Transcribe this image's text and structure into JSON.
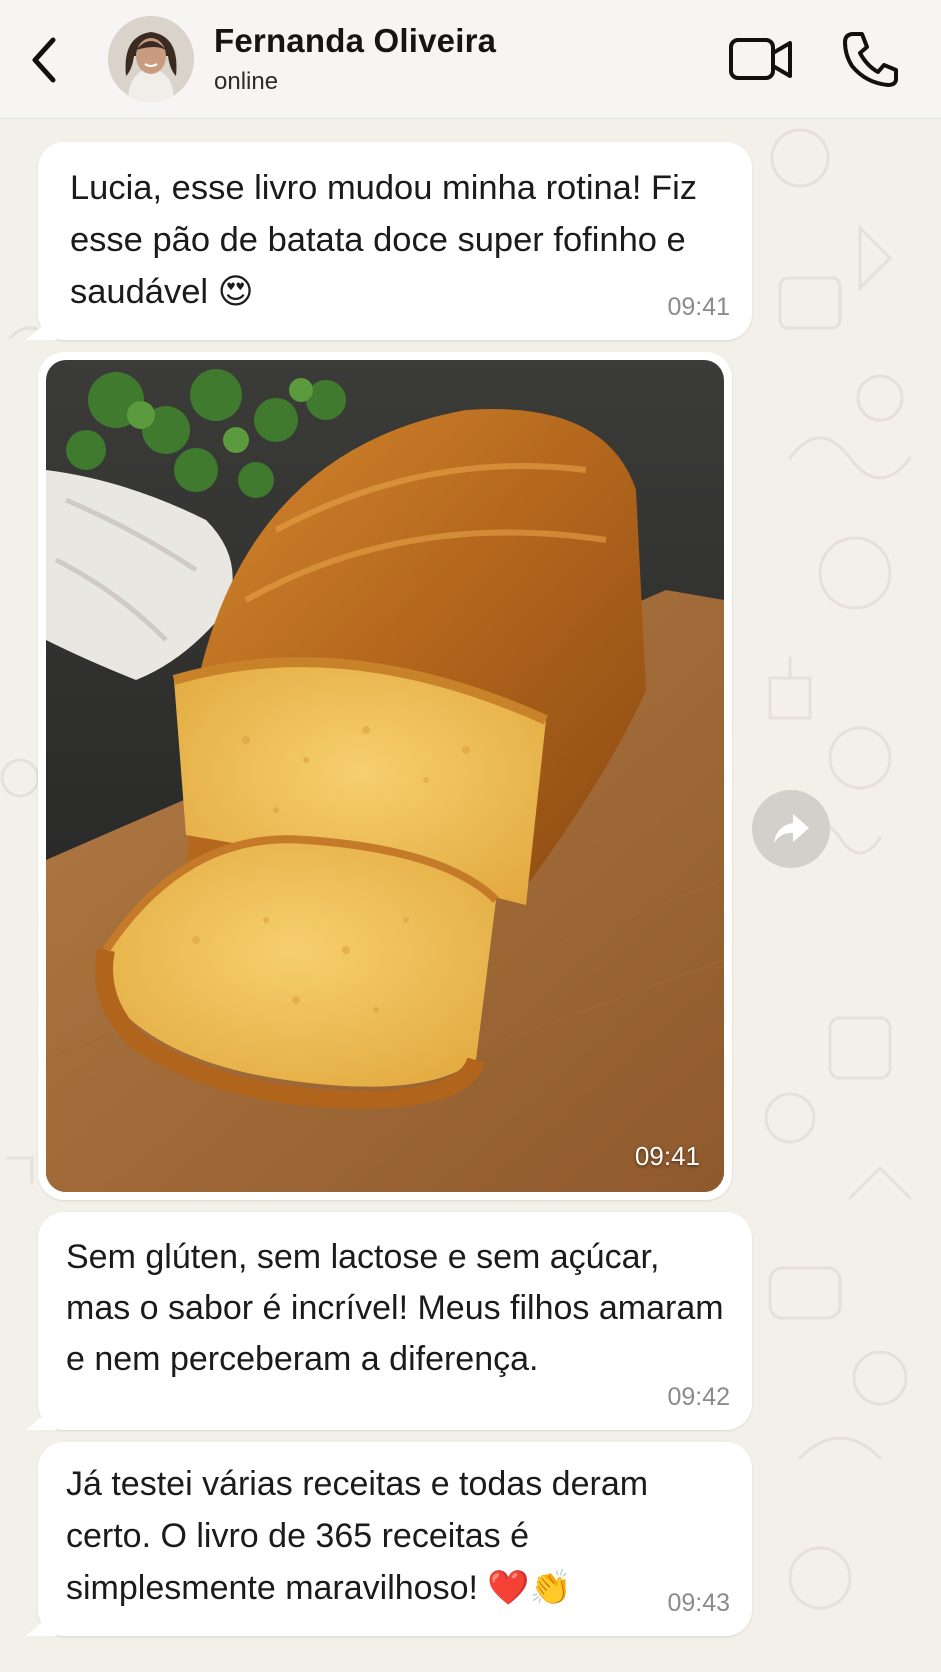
{
  "header": {
    "back_icon": "chevron-left-icon",
    "contact_name": "Fernanda Oliveira",
    "status": "online",
    "video_icon": "video-camera-icon",
    "call_icon": "phone-icon"
  },
  "messages": [
    {
      "type": "text",
      "text": "Lucia, esse livro mudou minha rotina! Fiz esse pão de batata doce super fofinho e saudável 😍",
      "time": "09:41"
    },
    {
      "type": "image",
      "image_subject": "loaf of bread on wooden cutting board",
      "time": "09:41"
    },
    {
      "type": "text",
      "text": "Sem glúten, sem lactose e sem açúcar, mas o sabor é incrível! Meus filhos amaram e nem perceberam a diferença.",
      "time": "09:42"
    },
    {
      "type": "text",
      "text": "Já testei várias receitas e todas deram certo. O livro de 365 receitas é simplesmente maravilhoso! ❤️👏",
      "time": "09:43"
    }
  ],
  "forward_icon": "forward-arrow-icon",
  "colors": {
    "wallpaper": "#f3efe9",
    "bubble": "#ffffff",
    "timestamp": "#8b8b8b"
  }
}
